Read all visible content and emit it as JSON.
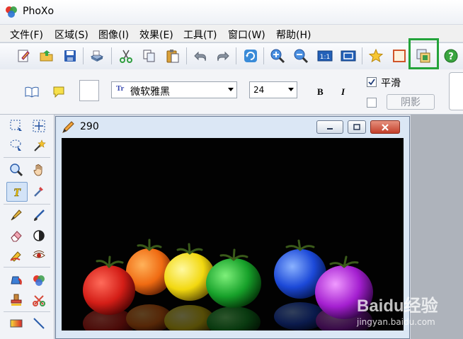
{
  "app": {
    "title": "PhoXo"
  },
  "menu": [
    "文件(F)",
    "区域(S)",
    "图像(I)",
    "效果(E)",
    "工具(T)",
    "窗口(W)",
    "帮助(H)"
  ],
  "toolbar": {
    "buttons": [
      "new-icon",
      "open-folder-icon",
      "save-icon",
      "scanner-icon",
      "cut-icon",
      "copy-icon",
      "paste-icon",
      "undo-icon",
      "redo-icon",
      "refresh-icon",
      "zoom-in-icon",
      "zoom-out-icon",
      "actual-size-icon",
      "fit-window-icon",
      "star-icon",
      "frame-icon",
      "layer-icon",
      "help-icon"
    ],
    "zoom_label": "1:1",
    "highlighted": "layer-icon",
    "highlight_color": "#23a33a"
  },
  "text_options": {
    "font": "微软雅黑",
    "size": "24",
    "bold_label": "B",
    "italic_label": "I",
    "smooth_label": "平滑",
    "smooth_checked": true,
    "shadow_label": "阴影",
    "shadow_checked": false
  },
  "palette": [
    "rect-select-icon",
    "move-icon",
    "lasso-icon",
    "magic-wand-icon",
    "zoom-icon",
    "hand-icon",
    "text-tool-icon",
    "eyedropper-icon",
    "pen-icon",
    "brush-icon",
    "eraser-icon",
    "contrast-icon",
    "smudge-icon",
    "red-eye-icon",
    "fill-icon",
    "color-replace-icon",
    "clone-stamp-icon",
    "stamp-icon",
    "gradient-icon",
    "line-icon"
  ],
  "document": {
    "title": "290"
  },
  "watermark": {
    "brand": "Baidu经验",
    "url": "jingyan.baidu.com"
  }
}
